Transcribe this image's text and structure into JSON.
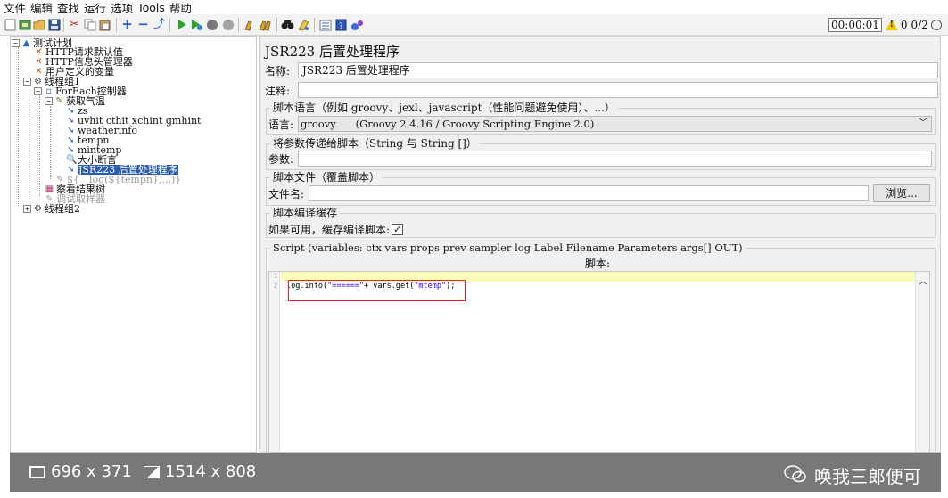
{
  "menu": [
    "文件",
    "编辑",
    "查找",
    "运行",
    "选项",
    "Tools",
    "帮助"
  ],
  "toolbar": {
    "icons": [
      "new-icon",
      "templates-icon",
      "open-icon",
      "save-icon",
      "cut-icon",
      "copy-icon",
      "paste-icon",
      "expand-icon",
      "collapse-icon",
      "toggle-icon",
      "start-icon",
      "start-no-pause-icon",
      "stop-icon",
      "shutdown-icon",
      "clear-icon",
      "clear-all-icon",
      "search-icon",
      "reset-search-icon",
      "function-helper-icon",
      "help-icon",
      "remote-icon"
    ],
    "timer": "00:00:01",
    "warnings": "0",
    "threads": "0/2"
  },
  "tree": {
    "nodes": [
      {
        "label": "测试计划",
        "icon": "test-plan-icon"
      },
      {
        "label": "HTTP请求默认值",
        "icon": "config-icon"
      },
      {
        "label": "HTTP信息头管理器",
        "icon": "config-icon"
      },
      {
        "label": "用户定义的变量",
        "icon": "config-icon"
      },
      {
        "label": "线程组1",
        "icon": "thread-group-icon"
      },
      {
        "label": "ForEach控制器",
        "icon": "controller-icon"
      },
      {
        "label": "获取气温",
        "icon": "sampler-icon"
      },
      {
        "label": "zs",
        "icon": "extractor-icon"
      },
      {
        "label": "uvhit cthit xchint gmhint",
        "icon": "extractor-icon"
      },
      {
        "label": "weatherinfo",
        "icon": "extractor-icon"
      },
      {
        "label": "tempn",
        "icon": "extractor-icon"
      },
      {
        "label": "mintemp",
        "icon": "extractor-icon"
      },
      {
        "label": "大小断言",
        "icon": "assertion-icon"
      },
      {
        "label": "JSR223 后置处理程序",
        "icon": "post-processor-icon"
      },
      {
        "label": "${__log(${tempn},...)}",
        "icon": "sampler-icon"
      },
      {
        "label": "察看结果树",
        "icon": "listener-icon"
      },
      {
        "label": "调试取样器",
        "icon": "sampler-icon"
      },
      {
        "label": "线程组2",
        "icon": "thread-group-icon"
      }
    ]
  },
  "panel": {
    "title": "JSR223 后置处理程序",
    "name_label": "名称:",
    "name_value": "JSR223 后置处理程序",
    "comment_label": "注释:",
    "comment_value": "",
    "lang_group": "脚本语言（例如 groovy、jexl、javascript（性能问题避免使用）、...）",
    "lang_label": "语言:",
    "lang_value": "groovy      (Groovy 2.4.16 / Groovy Scripting Engine 2.0)",
    "params_group": "将参数传递给脚本（String 与 String []）",
    "params_label": "参数:",
    "params_value": "",
    "file_group": "脚本文件（覆盖脚本）",
    "file_label": "文件名:",
    "file_value": "",
    "browse_label": "浏览...",
    "cache_group": "脚本编译缓存",
    "cache_label": "如果可用，缓存编译脚本:",
    "script_group": "Script (variables: ctx vars props prev sampler log Label Filename Parameters args[] OUT)",
    "script_label": "脚本:",
    "line_numbers": [
      "1",
      "2"
    ],
    "code_prefix": "log.info(",
    "code_str1": "\"======\"",
    "code_mid": "+ vars.get(",
    "code_str2": "\"mtemp\"",
    "code_suffix": ");"
  },
  "overlay": {
    "dim1": "696 x 371",
    "dim2": "1514 x 808",
    "watermark": "唤我三郎便可"
  }
}
